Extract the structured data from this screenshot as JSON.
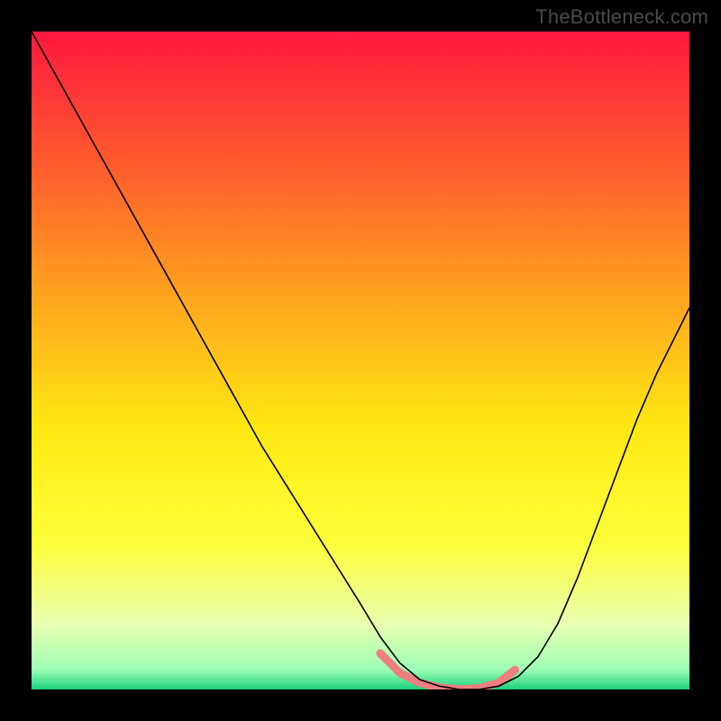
{
  "watermark": {
    "text": "TheBottleneck.com"
  },
  "chart_data": {
    "type": "line",
    "title": "",
    "xlabel": "",
    "ylabel": "",
    "xlim": [
      0,
      100
    ],
    "ylim": [
      0,
      100
    ],
    "grid": false,
    "legend": false,
    "background_gradient_stops": [
      {
        "offset": 0.0,
        "color": "#ff183f"
      },
      {
        "offset": 0.2,
        "color": "#ff5a2e"
      },
      {
        "offset": 0.4,
        "color": "#ffa31e"
      },
      {
        "offset": 0.6,
        "color": "#ffe812"
      },
      {
        "offset": 0.78,
        "color": "#fdff3a"
      },
      {
        "offset": 0.9,
        "color": "#e9ffb0"
      },
      {
        "offset": 0.97,
        "color": "#9cffb6"
      },
      {
        "offset": 1.0,
        "color": "#1bd17b"
      }
    ],
    "series": [
      {
        "name": "bottleneck-curve",
        "color": "#000000",
        "stroke_width": 1.6,
        "x": [
          0,
          5,
          10,
          15,
          20,
          25,
          30,
          35,
          40,
          45,
          50,
          53,
          56,
          59,
          62,
          65,
          68,
          71,
          74,
          77,
          80,
          83,
          86,
          89,
          92,
          95,
          98,
          100
        ],
        "values": [
          100,
          91,
          82,
          73,
          64,
          55,
          46,
          37,
          29,
          21,
          13,
          8,
          4,
          1.5,
          0.5,
          0,
          0,
          0.5,
          2,
          5,
          10,
          17,
          25,
          33,
          41,
          48,
          54,
          58
        ]
      }
    ],
    "markers": {
      "name": "highlight-segment",
      "color": "#ef7e80",
      "stroke_width": 9,
      "cap": "round",
      "x": [
        53,
        56,
        59,
        62,
        65,
        68,
        71,
        73.5
      ],
      "values": [
        5.5,
        2.5,
        1.0,
        0.3,
        0.0,
        0.2,
        1.0,
        3.0
      ]
    }
  }
}
